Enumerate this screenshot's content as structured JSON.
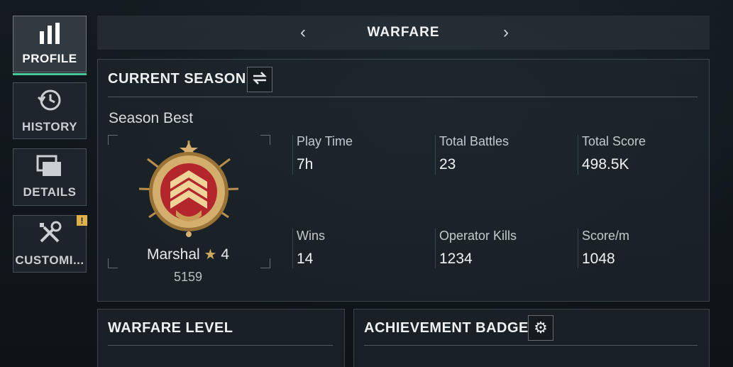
{
  "sidebar": {
    "items": [
      {
        "label": "PROFILE",
        "icon": "bar-chart-icon",
        "active": true
      },
      {
        "label": "HISTORY",
        "icon": "history-clock-icon"
      },
      {
        "label": "DETAILS",
        "icon": "folders-icon"
      },
      {
        "label": "CUSTOMI...",
        "icon": "tools-icon",
        "badge": "!"
      }
    ]
  },
  "header": {
    "title": "WARFARE",
    "prev_icon": "chevron-left-icon",
    "next_icon": "chevron-right-icon"
  },
  "current_season": {
    "title": "CURRENT SEASON",
    "swap_icon": "swap-arrows-icon",
    "season_best_label": "Season Best",
    "rank": {
      "name": "Marshal",
      "star_icon": "star-icon",
      "tier": "4",
      "score": "5159"
    },
    "stats": [
      {
        "label": "Play Time",
        "value": "7h"
      },
      {
        "label": "Total Battles",
        "value": "23"
      },
      {
        "label": "Total Score",
        "value": "498.5K"
      },
      {
        "label": "Wins",
        "value": "14"
      },
      {
        "label": "Operator Kills",
        "value": "1234"
      },
      {
        "label": "Score/m",
        "value": "1048"
      }
    ]
  },
  "warfare_level": {
    "title": "WARFARE LEVEL"
  },
  "achievement_badge": {
    "title": "ACHIEVEMENT BADGE",
    "settings_icon": "gear-icon"
  },
  "colors": {
    "accent": "#49c79a",
    "badge": "#e0b04a",
    "medal_red": "#b3262c",
    "medal_gold": "#c9a15a"
  }
}
